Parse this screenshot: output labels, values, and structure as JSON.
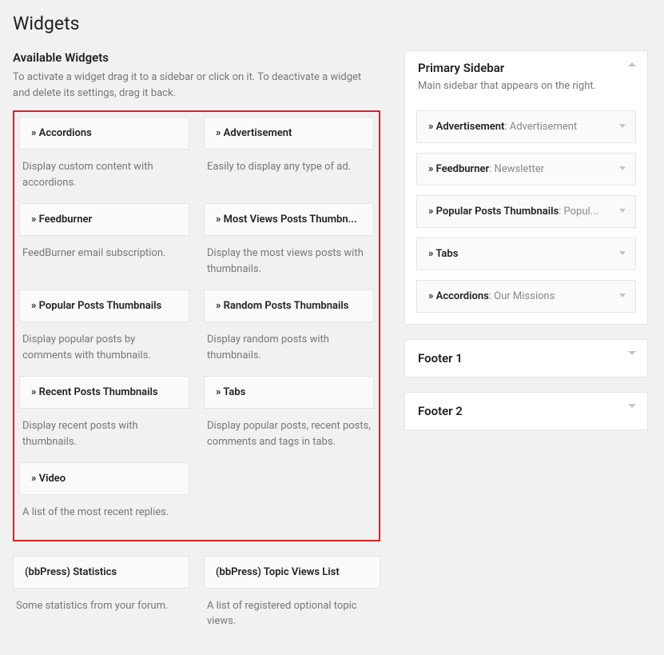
{
  "page": {
    "title": "Widgets"
  },
  "available": {
    "title": "Available Widgets",
    "desc": "To activate a widget drag it to a sidebar or click on it. To deactivate a widget and delete its settings, drag it back.",
    "highlighted": [
      {
        "title": "» Accordions",
        "desc": "Display custom content with accordions."
      },
      {
        "title": "» Advertisement",
        "desc": "Easily to display any type of ad."
      },
      {
        "title": "» Feedburner",
        "desc": "FeedBurner email subscription."
      },
      {
        "title": "» Most Views Posts Thumbn...",
        "desc": "Display the most views posts with thumbnails."
      },
      {
        "title": "» Popular Posts Thumbnails",
        "desc": "Display popular posts by comments with thumbnails."
      },
      {
        "title": "» Random Posts Thumbnails",
        "desc": "Display random posts with thumbnails."
      },
      {
        "title": "» Recent Posts Thumbnails",
        "desc": "Display recent posts with thumbnails."
      },
      {
        "title": "» Tabs",
        "desc": "Display popular posts, recent posts, comments and tags in tabs."
      },
      {
        "title": "» Video",
        "desc": "A list of the most recent replies."
      }
    ],
    "others": [
      {
        "title": "(bbPress) Statistics",
        "desc": "Some statistics from your forum."
      },
      {
        "title": "(bbPress) Topic Views List",
        "desc": "A list of registered optional topic views."
      }
    ]
  },
  "areas": {
    "primary": {
      "title": "Primary Sidebar",
      "desc": "Main sidebar that appears on the right.",
      "items": [
        {
          "name": "» Advertisement",
          "suffix": ": Advertisement"
        },
        {
          "name": "» Feedburner",
          "suffix": ": Newsletter"
        },
        {
          "name": "» Popular Posts Thumbnails",
          "suffix": ": Popul..."
        },
        {
          "name": "» Tabs",
          "suffix": ""
        },
        {
          "name": "» Accordions",
          "suffix": ": Our Missions"
        }
      ]
    },
    "footer1": {
      "title": "Footer 1"
    },
    "footer2": {
      "title": "Footer 2"
    }
  }
}
